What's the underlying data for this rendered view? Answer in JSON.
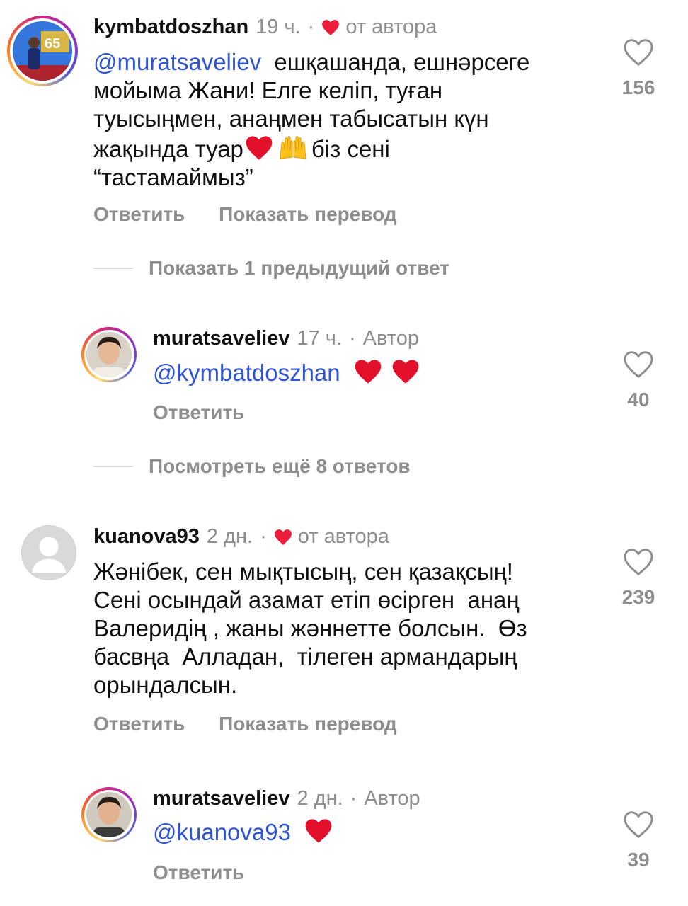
{
  "comments": [
    {
      "username": "kymbatdoszhan",
      "time": "19 ч.",
      "tag": "от автора",
      "mention": "@muratsaveliev",
      "line1": "ешқашанда, ешнәрсеге",
      "line2": "мойыма Жани! Елге келіп, туған",
      "line3": "туысыңмен, анаңмен табысатын күн",
      "line4a": "жақында туар",
      "line4b": "біз сені",
      "line5": "“тастамаймыз”",
      "reply_label": "Ответить",
      "translate_label": "Показать перевод",
      "likes": "156"
    },
    {
      "username": "muratsaveliev",
      "time": "17 ч.",
      "tag": "Автор",
      "mention": "@kymbatdoszhan",
      "reply_label": "Ответить",
      "likes": "40"
    },
    {
      "username": "kuanova93",
      "time": "2 дн.",
      "tag": "от автора",
      "line1": "Жәнібек, сен мықтысың, сен қазақсың!",
      "line2": "Сені осындай азамат етіп өсірген  анаң",
      "line3": "Валеридің , жаны жәннетте болсын.  Өз",
      "line4": "басвңа  Алладан,  тілеген армандарың",
      "line5": "орындалсын.",
      "reply_label": "Ответить",
      "translate_label": "Показать перевод",
      "likes": "239"
    },
    {
      "username": "muratsaveliev",
      "time": "2 дн.",
      "tag": "Автор",
      "mention": "@kuanova93",
      "reply_label": "Ответить",
      "likes": "39"
    }
  ],
  "threads": {
    "show_previous": "Показать 1 предыдущий ответ",
    "show_more": "Посмотреть ещё 8 ответов"
  },
  "avatar_badge": "65",
  "colors": {
    "mention": "#2f55d4",
    "muted": "#8e8e8e",
    "heart": "#ed1c3a"
  },
  "icons": [
    "heart-outline-icon",
    "heart-filled-icon",
    "raising-hands-emoji"
  ]
}
